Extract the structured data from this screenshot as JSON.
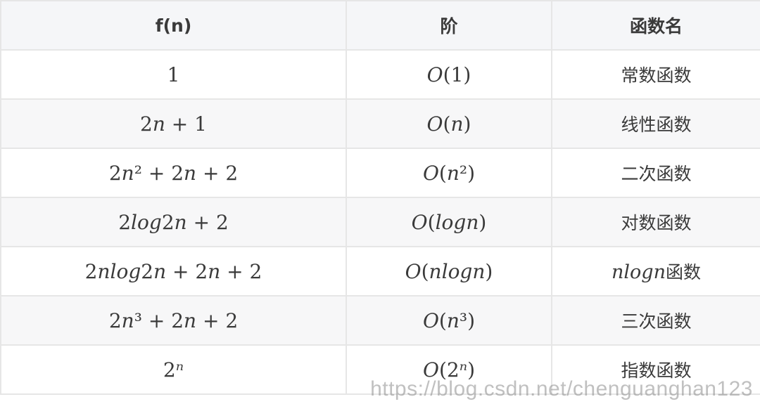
{
  "headers": [
    "f(n)",
    "阶",
    "函数名"
  ],
  "rows": [
    {
      "fn": "1",
      "order": "O(1)",
      "name": "常数函数"
    },
    {
      "fn": "2n + 1",
      "order": "O(n)",
      "name": "线性函数"
    },
    {
      "fn": "2n² + 2n + 2",
      "order": "O(n²)",
      "name": "二次函数"
    },
    {
      "fn": "2log2n + 2",
      "order": "O(logn)",
      "name": "对数函数"
    },
    {
      "fn": "2nlog2n + 2n + 2",
      "order": "O(nlogn)",
      "name": "nlogn函数"
    },
    {
      "fn": "2n³ + 2n + 2",
      "order": "O(n³)",
      "name": "三次函数"
    },
    {
      "fn": "2ⁿ",
      "order": "O(2ⁿ)",
      "name": "指数函数"
    }
  ],
  "watermark": "https://blog.csdn.net/chenguanghan123"
}
